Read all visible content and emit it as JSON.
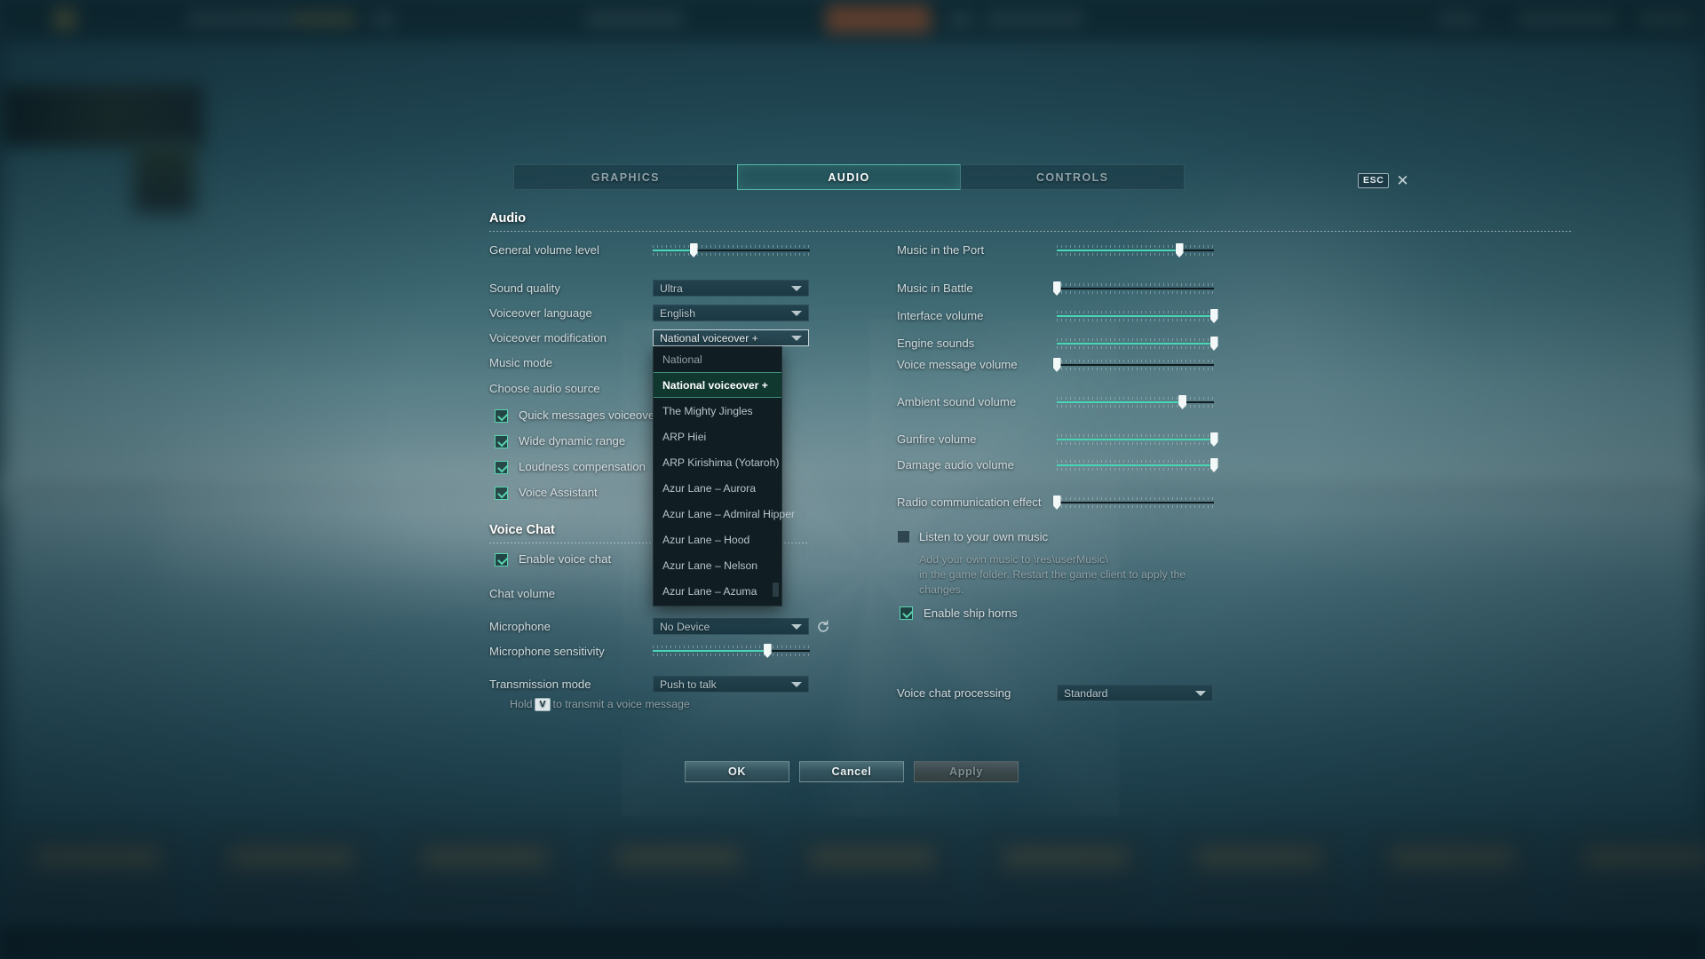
{
  "window": {
    "esc_key_label": "ESC",
    "close_icon": "close-icon"
  },
  "tabs": [
    {
      "label": "GRAPHICS",
      "active": false
    },
    {
      "label": "AUDIO",
      "active": true
    },
    {
      "label": "CONTROLS",
      "active": false
    }
  ],
  "audio_section": {
    "title": "Audio",
    "general_volume": {
      "label": "General volume level",
      "value": 26
    },
    "selects": [
      {
        "label": "Sound quality",
        "value": "Ultra",
        "open": false
      },
      {
        "label": "Voiceover language",
        "value": "English",
        "open": false
      },
      {
        "label": "Voiceover modification",
        "value": "National voiceover +",
        "open": true
      },
      {
        "label": "Music mode",
        "value": "National",
        "open": false
      },
      {
        "label": "Choose audio source",
        "value": "",
        "open": false
      }
    ],
    "voiceover_options": [
      "National",
      "National voiceover +",
      "The Mighty Jingles",
      "ARP Hiei",
      "ARP Kirishima (Yotaroh)",
      "Azur Lane – Aurora",
      "Azur Lane – Admiral Hipper",
      "Azur Lane – Hood",
      "Azur Lane – Nelson",
      "Azur Lane – Azuma"
    ],
    "voiceover_selected": "National voiceover +",
    "checkboxes": [
      {
        "label": "Quick messages voiceover",
        "checked": true
      },
      {
        "label": "Wide dynamic range",
        "checked": true
      },
      {
        "label": "Loudness compensation",
        "checked": true
      },
      {
        "label": "Voice Assistant",
        "checked": true
      }
    ]
  },
  "voice_chat_section": {
    "title": "Voice Chat",
    "enable": {
      "label": "Enable voice chat",
      "checked": true
    },
    "chat_volume_label": "Chat volume",
    "microphone": {
      "label": "Microphone",
      "value": "No Device",
      "refresh_icon": "refresh-icon"
    },
    "mic_sensitivity": {
      "label": "Microphone sensitivity",
      "value": 73
    },
    "transmission_mode": {
      "label": "Transmission mode",
      "value": "Push to talk"
    },
    "hint_prefix": "Hold",
    "hint_key": "V",
    "hint_suffix": "to transmit a voice message"
  },
  "right_column": {
    "sliders": [
      {
        "label": "Music in the Port",
        "value": 78
      },
      {
        "label": "Music in Battle",
        "value": 0
      },
      {
        "label": "Interface volume",
        "value": 100
      },
      {
        "label": "Engine sounds",
        "value": 100
      },
      {
        "label": "Voice message volume",
        "value": 0
      },
      {
        "label": "Ambient sound volume",
        "value": 80
      },
      {
        "label": "Gunfire volume",
        "value": 100
      },
      {
        "label": "Damage audio volume",
        "value": 100
      },
      {
        "label": "Radio communication effect",
        "value": 0
      }
    ],
    "own_music": {
      "label": "Listen to your own music",
      "checked": false,
      "description_line1": "Add your own music to \\res\\userMusic\\",
      "description_line2": "in the game folder. Restart the game client to apply the",
      "description_line3": "changes."
    },
    "ship_horns": {
      "label": "Enable ship horns",
      "checked": true
    },
    "voice_chat_processing": {
      "label": "Voice chat processing",
      "value": "Standard"
    }
  },
  "footer": {
    "ok": "OK",
    "cancel": "Cancel",
    "apply": "Apply"
  },
  "colors": {
    "accent": "#49d6b4",
    "tab_active_border": "#56b9a8",
    "panel_bg": "#101d22",
    "select_highlight": "#11382f"
  }
}
